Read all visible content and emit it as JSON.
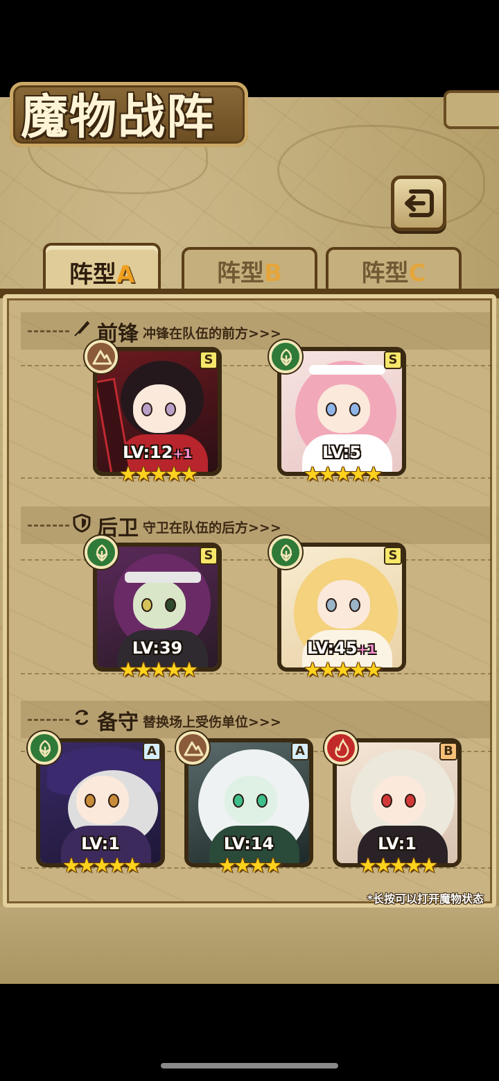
{
  "title": "魔物战阵",
  "back_icon": "back-arrow-icon",
  "tabs": [
    {
      "label": "阵型",
      "letter": "A",
      "active": true
    },
    {
      "label": "阵型",
      "letter": "B",
      "active": false
    },
    {
      "label": "阵型",
      "letter": "C",
      "active": false
    }
  ],
  "sections": {
    "front": {
      "title": "前锋",
      "subtitle": "冲锋在队伍的前方>>>",
      "icon": "sword-icon"
    },
    "back": {
      "title": "后卫",
      "subtitle": "守卫在队伍的后方>>>",
      "icon": "shield-icon"
    },
    "reserve": {
      "title": "备守",
      "subtitle": "替换场上受伤单位>>>",
      "icon": "swap-icon"
    }
  },
  "cards": {
    "front": [
      {
        "element": "earth",
        "rank": "S",
        "level": "LV:12",
        "bonus": "+1",
        "stars": "★★★★★"
      },
      {
        "element": "wind",
        "rank": "S",
        "level": "LV:5",
        "bonus": "",
        "stars": "★★★★★"
      }
    ],
    "back": [
      {
        "element": "wind",
        "rank": "S",
        "level": "LV:39",
        "bonus": "",
        "stars": "★★★★★"
      },
      {
        "element": "wind",
        "rank": "S",
        "level": "LV:45",
        "bonus": "+1",
        "stars": "★★★★★"
      }
    ],
    "reserve": [
      {
        "element": "wind",
        "rank": "A",
        "level": "LV:1",
        "bonus": "",
        "stars": "★★★★★"
      },
      {
        "element": "earth",
        "rank": "A",
        "level": "LV:14",
        "bonus": "",
        "stars": "★★★★"
      },
      {
        "element": "fire",
        "rank": "B",
        "level": "LV:1",
        "bonus": "",
        "stars": "★★★★★"
      }
    ]
  },
  "hint": "*长按可以打开魔物状态",
  "colors": {
    "accent": "#f0a020",
    "rank_s_frame": "#f4e35a",
    "rank_a_frame": "#a9dcef",
    "rank_b_frame": "#f0a958"
  }
}
